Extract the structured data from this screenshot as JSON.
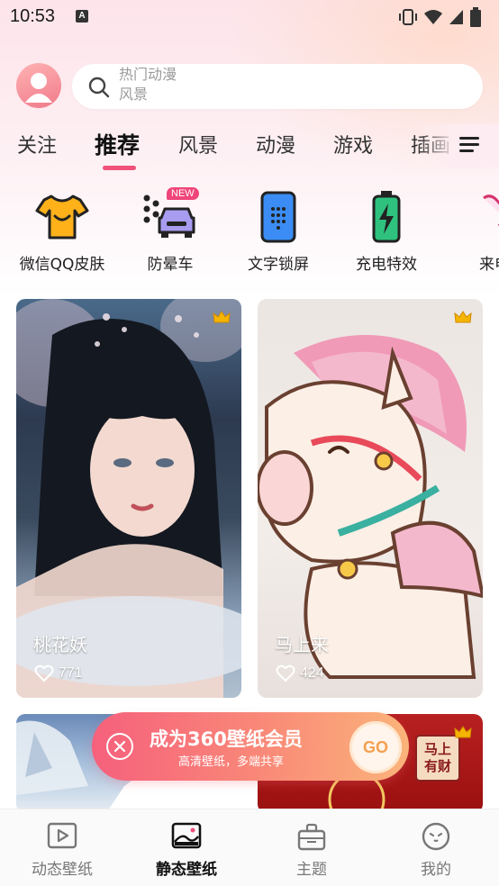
{
  "status_bar": {
    "time": "10:53",
    "notification_icon": "A"
  },
  "header": {
    "search_placeholder_line1": "热门动漫",
    "search_placeholder_line2": "风景"
  },
  "tabs": [
    {
      "label": "关注",
      "active": false
    },
    {
      "label": "推荐",
      "active": true
    },
    {
      "label": "风景",
      "active": false
    },
    {
      "label": "动漫",
      "active": false
    },
    {
      "label": "游戏",
      "active": false
    },
    {
      "label": "插画",
      "active": false
    }
  ],
  "categories": [
    {
      "label": "微信QQ皮肤",
      "icon": "tshirt-icon"
    },
    {
      "label": "防晕车",
      "icon": "car-icon",
      "badge": "NEW"
    },
    {
      "label": "文字锁屏",
      "icon": "text-lock-icon"
    },
    {
      "label": "充电特效",
      "icon": "battery-charging-icon"
    },
    {
      "label": "来电",
      "icon": "phone-icon"
    }
  ],
  "cards": [
    {
      "title": "桃花妖",
      "likes": "771",
      "premium": true
    },
    {
      "title": "马上来",
      "likes": "424",
      "premium": true
    },
    {
      "title": "",
      "likes": "",
      "premium": false
    },
    {
      "title": "",
      "likes": "",
      "premium": true,
      "art_text": "马上有财"
    }
  ],
  "promo": {
    "title": "成为360壁纸会员",
    "subtitle": "高清壁纸，多端共享",
    "button": "GO"
  },
  "bottom_nav": [
    {
      "label": "动态壁纸",
      "icon": "play-icon",
      "active": false
    },
    {
      "label": "静态壁纸",
      "icon": "image-icon",
      "active": true
    },
    {
      "label": "主题",
      "icon": "theme-icon",
      "active": false
    },
    {
      "label": "我的",
      "icon": "profile-face-icon",
      "active": false
    }
  ],
  "colors": {
    "accent": "#f0507a",
    "promo_start": "#f6607c",
    "promo_end": "#fbb47a",
    "badge": "#f0457a"
  }
}
